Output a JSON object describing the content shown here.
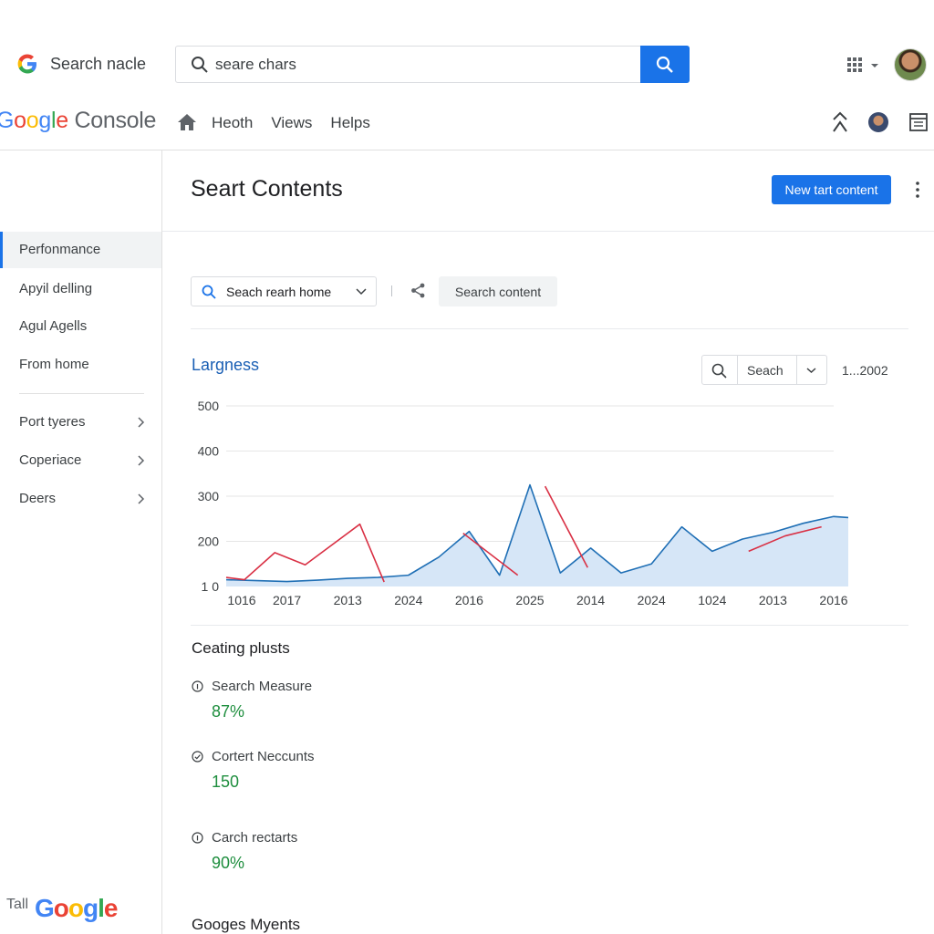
{
  "topbar": {
    "brand": "Search nacle",
    "search_value": "seare chars",
    "apps_icon": "apps-grid-icon",
    "avatar": "user-avatar"
  },
  "console": {
    "title_parts": [
      "G",
      "o",
      "o",
      "g",
      "l",
      "e"
    ],
    "title_rest": " Console",
    "nav": [
      "Heoth",
      "Views",
      "Helps"
    ]
  },
  "sidebar": {
    "items": [
      {
        "label": "Perfonmance",
        "active": true
      },
      {
        "label": "Apyil delling"
      },
      {
        "label": "Agul Agells"
      },
      {
        "label": "From home"
      },
      {
        "label": "Port tyeres",
        "chevron": true
      },
      {
        "label": "Coperiace",
        "chevron": true
      },
      {
        "label": "Deers",
        "chevron": true
      }
    ],
    "footer_prefix": "Tall",
    "footer_logo": [
      "G",
      "o",
      "o",
      "g",
      "l",
      "e"
    ]
  },
  "main": {
    "title": "Seart Contents",
    "new_button": "New tart content",
    "filter_select": "Seach rearh home",
    "search_content_button": "Search content",
    "chart_title": "Largness",
    "chart_search_label": "Seach",
    "chart_range": "1...2002",
    "section_title": "Ceating plusts",
    "metrics": [
      {
        "label": "Search Measure",
        "value": "87%"
      },
      {
        "label": "Cortert Neccunts",
        "value": "150"
      },
      {
        "label": "Carch rectarts",
        "value": "90%"
      }
    ],
    "bottom_title": "Googes Myents"
  },
  "colors": {
    "accent": "#1a73e8",
    "line_blue": "#1f6fb5",
    "line_red": "#d93044",
    "area_fill": "#d6e6f7",
    "metric_green": "#1e8e3e"
  },
  "chart_data": {
    "type": "area",
    "y_ticks": [
      "500",
      "400",
      "300",
      "200",
      "1 0"
    ],
    "ylim": [
      100,
      500
    ],
    "x_ticks": [
      "1016",
      "2017",
      "2013",
      "2024",
      "2016",
      "2025",
      "2014",
      "2024",
      "1024",
      "2013",
      "2016"
    ],
    "series": [
      {
        "color": "#1f6fb5",
        "x": [
          0,
          0.5,
          1,
          1.5,
          2,
          2.5,
          3,
          3.5,
          4,
          4.5,
          5,
          5.5,
          6,
          6.5,
          7,
          7.5,
          8,
          8.5,
          9,
          9.5,
          10,
          10.3
        ],
        "values": [
          115,
          113,
          111,
          114,
          118,
          120,
          125,
          165,
          222,
          125,
          325,
          130,
          185,
          130,
          150,
          232,
          178,
          205,
          220,
          240,
          255,
          252
        ]
      },
      {
        "color": "#d93044",
        "x": [
          0,
          0.3,
          0.8,
          1.3,
          2.2,
          2.6
        ],
        "values": [
          120,
          115,
          175,
          148,
          238,
          110
        ]
      },
      {
        "color": "#d93044",
        "x": [
          3.9,
          4.8
        ],
        "values": [
          218,
          125
        ]
      },
      {
        "color": "#d93044",
        "x": [
          5.25,
          5.95
        ],
        "values": [
          322,
          142
        ]
      },
      {
        "color": "#d93044",
        "x": [
          8.6,
          9.2,
          9.8
        ],
        "values": [
          178,
          212,
          232
        ]
      }
    ]
  }
}
